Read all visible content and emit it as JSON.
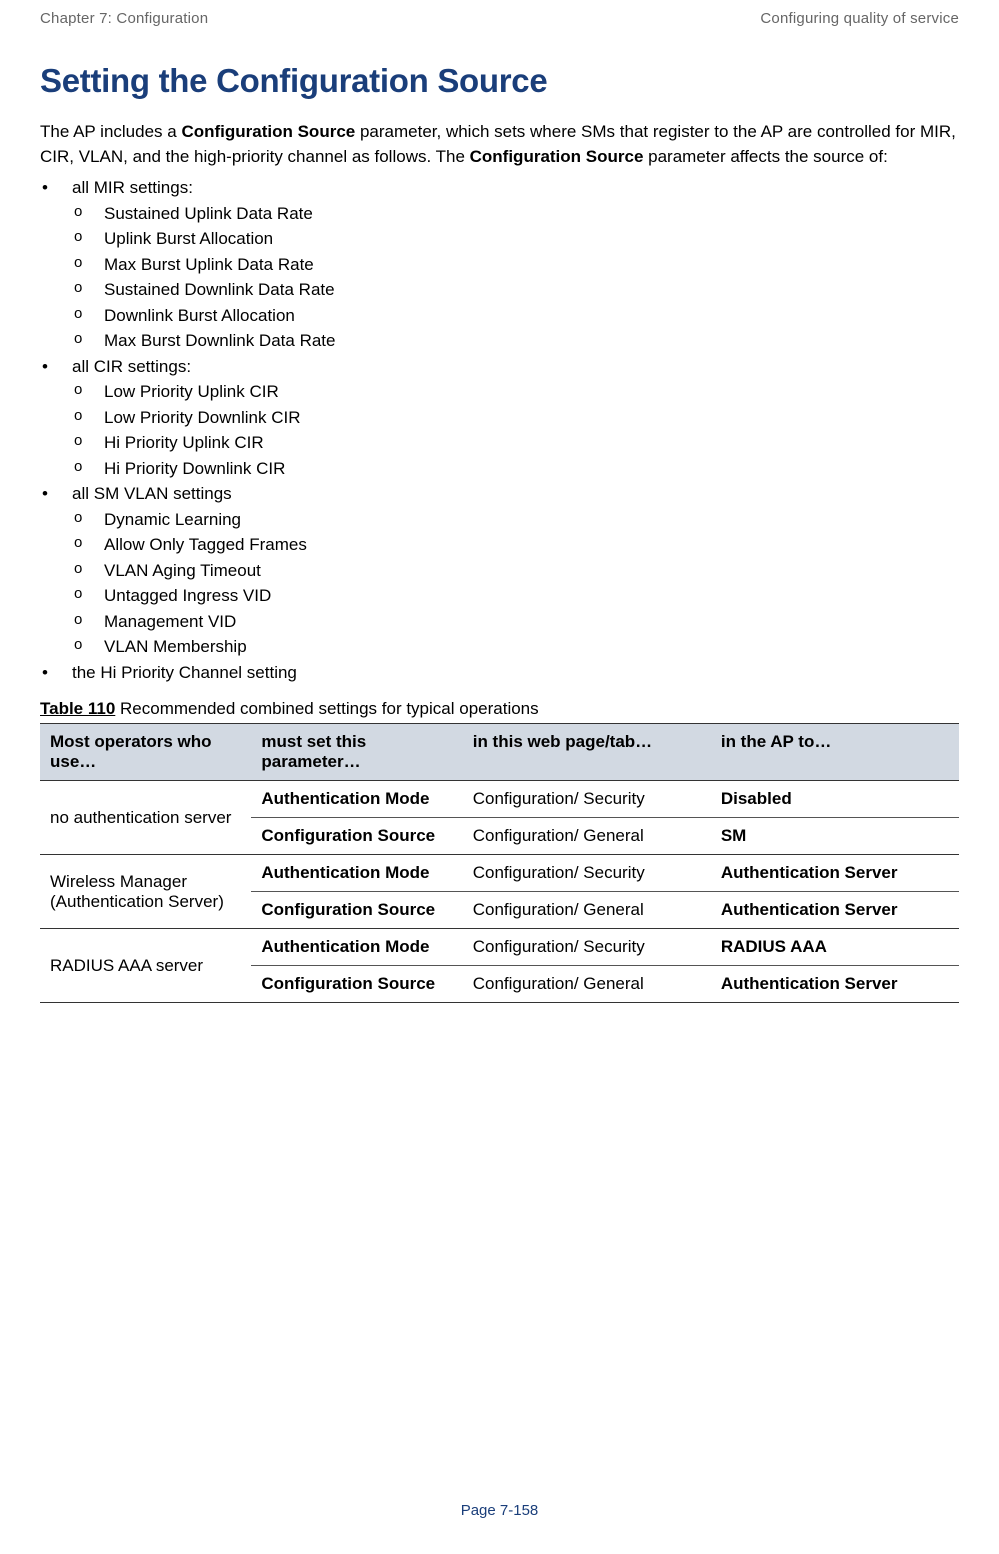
{
  "header": {
    "left": "Chapter 7:  Configuration",
    "right": "Configuring quality of service"
  },
  "title": "Setting the Configuration Source",
  "intro": {
    "pre": "The AP includes a ",
    "b1": "Configuration Source",
    "mid": " parameter, which sets where SMs that register to the AP are controlled for MIR, CIR, VLAN, and the high-priority channel as follows. The ",
    "b2": "Configuration Source",
    "post": " parameter affects the source of:"
  },
  "lists": [
    {
      "label": "all MIR settings:",
      "items": [
        "Sustained Uplink Data Rate",
        "Uplink Burst Allocation",
        "Max Burst Uplink Data Rate",
        "Sustained Downlink Data Rate",
        "Downlink Burst Allocation",
        "Max Burst Downlink Data Rate"
      ]
    },
    {
      "label": "all CIR settings:",
      "items": [
        "Low Priority Uplink CIR",
        "Low Priority Downlink CIR",
        "Hi Priority Uplink CIR",
        "Hi Priority Downlink CIR"
      ]
    },
    {
      "label": "all SM VLAN settings",
      "items": [
        "Dynamic Learning",
        "Allow Only Tagged Frames",
        "VLAN Aging Timeout",
        "Untagged Ingress VID",
        "Management VID",
        "VLAN Membership"
      ]
    },
    {
      "label": "the Hi Priority Channel setting",
      "items": []
    }
  ],
  "table_caption": {
    "label": "Table 110",
    "text": " Recommended combined settings for typical operations"
  },
  "table": {
    "headers": [
      "Most operators who use…",
      "must set this parameter…",
      "in this web page/tab…",
      "in the AP to…"
    ],
    "groups": [
      {
        "label": "no authentication server",
        "rows": [
          {
            "param": "Authentication Mode",
            "page": "Configuration/ Security",
            "value": "Disabled",
            "value_bold": true
          },
          {
            "param": "Configuration Source",
            "page": "Configuration/ General",
            "value": "SM",
            "value_bold": true
          }
        ]
      },
      {
        "label": "Wireless Manager (Authentication Server)",
        "rows": [
          {
            "param": "Authentication Mode",
            "page": "Configuration/ Security",
            "value": "Authentication Server",
            "value_bold": true
          },
          {
            "param": "Configuration Source",
            "page": "Configuration/ General",
            "value": "Authentication Server",
            "value_bold": true
          }
        ]
      },
      {
        "label": "RADIUS AAA server",
        "rows": [
          {
            "param": "Authentication Mode",
            "page": "Configuration/ Security",
            "value": "RADIUS AAA",
            "value_bold": true
          },
          {
            "param": "Configuration Source",
            "page": "Configuration/ General",
            "value": "Authentication Server",
            "value_bold": true
          }
        ]
      }
    ]
  },
  "page_number": "Page 7-158"
}
